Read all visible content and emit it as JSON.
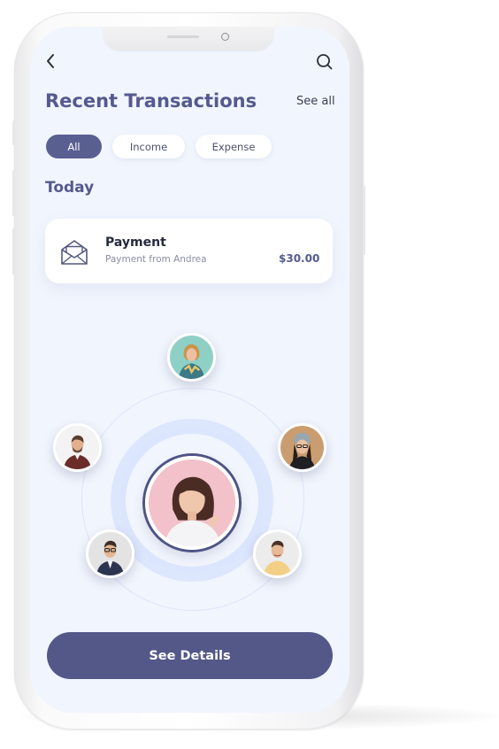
{
  "header": {
    "title": "Recent Transactions",
    "see_all_label": "See all",
    "back_icon": "chevron-left-icon",
    "search_icon": "search-icon"
  },
  "filters": [
    {
      "label": "All",
      "selected": true
    },
    {
      "label": "Income",
      "selected": false
    },
    {
      "label": "Expense",
      "selected": false
    }
  ],
  "section": {
    "title": "Today"
  },
  "transaction": {
    "icon": "envelope-icon",
    "title": "Payment",
    "subtitle": "Payment from Andrea",
    "amount": "$30.00"
  },
  "contacts": {
    "center": {
      "role": "main-user-avatar"
    },
    "others": [
      {
        "name": "contact-avatar-top"
      },
      {
        "name": "contact-avatar-left"
      },
      {
        "name": "contact-avatar-right"
      },
      {
        "name": "contact-avatar-bottom-left"
      },
      {
        "name": "contact-avatar-bottom-right"
      }
    ]
  },
  "cta": {
    "label": "See Details"
  },
  "colors": {
    "primary": "#545a8e",
    "button": "#535889",
    "background": "#f1f5fd",
    "card": "#ffffff",
    "ring": "#dde4fb"
  }
}
